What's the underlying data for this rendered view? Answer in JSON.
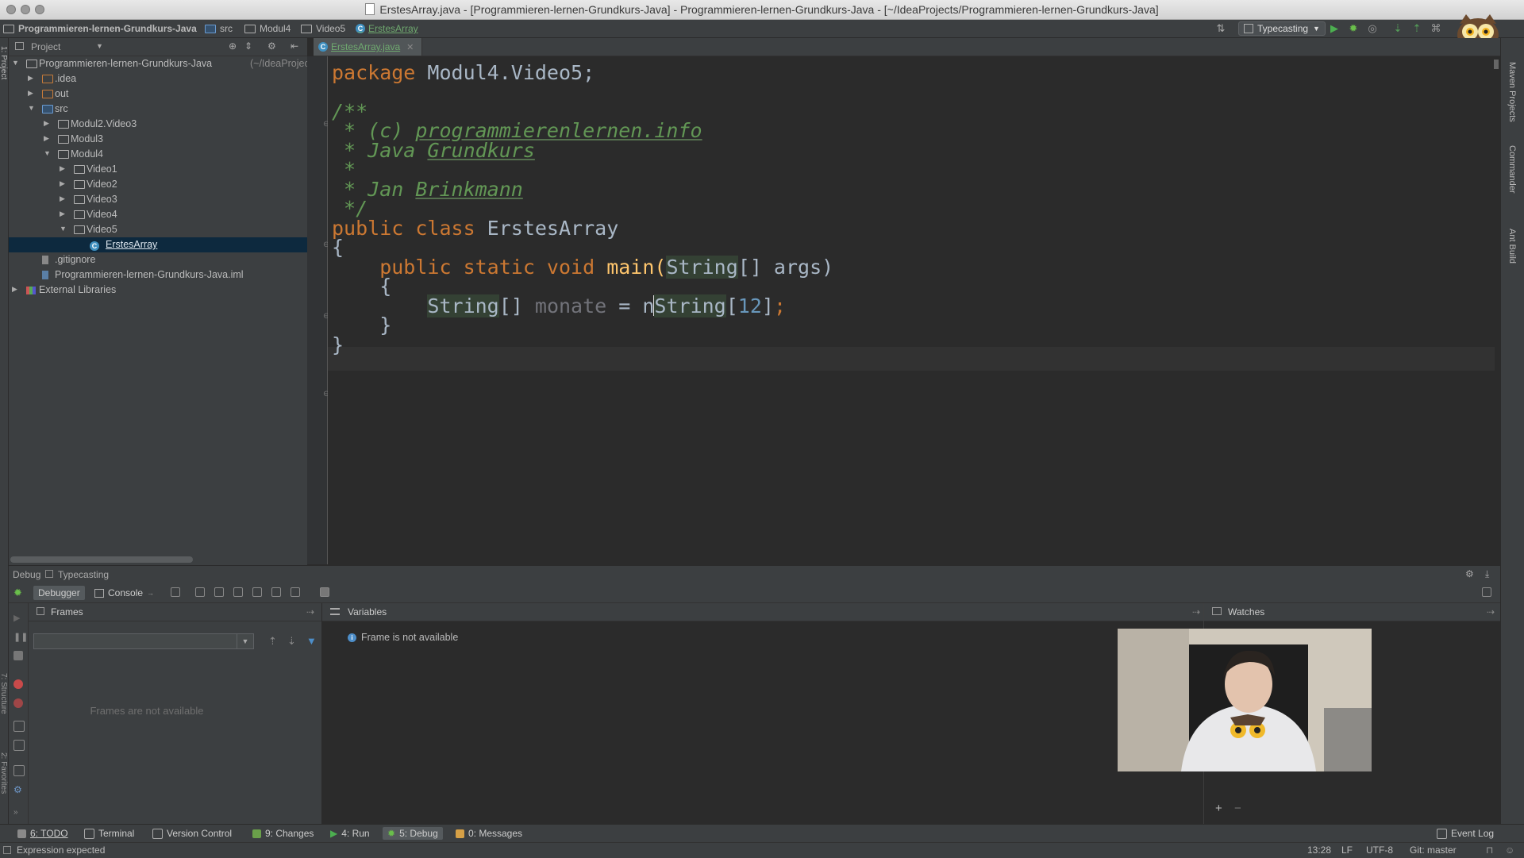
{
  "window": {
    "title": "ErstesArray.java - [Programmieren-lernen-Grundkurs-Java] - Programmieren-lernen-Grundkurs-Java - [~/IdeaProjects/Programmieren-lernen-Grundkurs-Java]"
  },
  "breadcrumbs": [
    "Programmieren-lernen-Grundkurs-Java",
    "src",
    "Modul4",
    "Video5",
    "ErstesArray"
  ],
  "toolbar": {
    "run_config": "Typecasting"
  },
  "project": {
    "header": "Project",
    "tree": [
      {
        "label": "Programmieren-lernen-Grundkurs-Java",
        "suffix": "(~/IdeaProjects/P",
        "level": 0,
        "expanded": true
      },
      {
        "label": ".idea",
        "level": 1,
        "expanded": false
      },
      {
        "label": "out",
        "level": 1,
        "expanded": false
      },
      {
        "label": "src",
        "level": 1,
        "expanded": true
      },
      {
        "label": "Modul2.Video3",
        "level": 2,
        "expanded": false
      },
      {
        "label": "Modul3",
        "level": 2,
        "expanded": false
      },
      {
        "label": "Modul4",
        "level": 2,
        "expanded": true
      },
      {
        "label": "Video1",
        "level": 3,
        "expanded": false
      },
      {
        "label": "Video2",
        "level": 3,
        "expanded": false
      },
      {
        "label": "Video3",
        "level": 3,
        "expanded": false
      },
      {
        "label": "Video4",
        "level": 3,
        "expanded": false
      },
      {
        "label": "Video5",
        "level": 3,
        "expanded": true
      },
      {
        "label": "ErstesArray",
        "level": 4,
        "selected": true
      },
      {
        "label": ".gitignore",
        "level": 1
      },
      {
        "label": "Programmieren-lernen-Grundkurs-Java.iml",
        "level": 1
      },
      {
        "label": "External Libraries",
        "level": 0,
        "expanded": false
      }
    ]
  },
  "editor": {
    "tab_label": "ErstesArray.java",
    "code": {
      "line1_kw": "package",
      "line1_rest": " Modul4.Video5;",
      "line2": "/**",
      "line3_pre": " * (c) ",
      "line3_link": "programmierenlernen.info",
      "line4_pre": " * Java ",
      "line4_word": "Grundkurs",
      "line5": " *",
      "line6_pre": " * Jan ",
      "line6_word": "Brinkmann",
      "line7": " */",
      "line8_kw": "public class",
      "line8_rest": " ErstesArray",
      "line9": "{",
      "line10_kw": "    public static void",
      "line10_name": " main(",
      "line10_type": "String",
      "line10_rest": "[] args)",
      "line11": "    {",
      "line12_indent": "        ",
      "line12_type": "String",
      "line12_arr": "[] ",
      "line12_var": "monate",
      "line12_eq": " = ",
      "line12_n": "n",
      "line12_type2": "String",
      "line12_br1": "[",
      "line12_num": "12",
      "line12_br2": "]",
      "line12_semi": ";",
      "line13": "    }",
      "line14": "}"
    }
  },
  "right_stripe": {
    "maven": "Maven Projects",
    "commander": "Commander",
    "ant": "Ant Build"
  },
  "debug": {
    "title": "Debug",
    "config": "Typecasting",
    "tab_debugger": "Debugger",
    "tab_console": "Console",
    "frames_header": "Frames",
    "frames_empty": "Frames are not available",
    "variables_header": "Variables",
    "variables_msg": "Frame is not available",
    "watches_header": "Watches"
  },
  "bottom_tools": {
    "todo": "6: TODO",
    "terminal": "Terminal",
    "vcs": "Version Control",
    "changes": "9: Changes",
    "run": "4: Run",
    "debug": "5: Debug",
    "messages": "0: Messages",
    "event_log": "Event Log"
  },
  "status": {
    "message": "Expression expected",
    "position": "13:28",
    "line_sep": "LF",
    "encoding": "UTF-8",
    "git": "Git: master"
  },
  "colors": {
    "background": "#2b2b2b",
    "panel": "#3c3f41",
    "keyword": "#cc7832",
    "comment": "#629755",
    "number": "#6897bb",
    "selection": "#0d293e"
  }
}
